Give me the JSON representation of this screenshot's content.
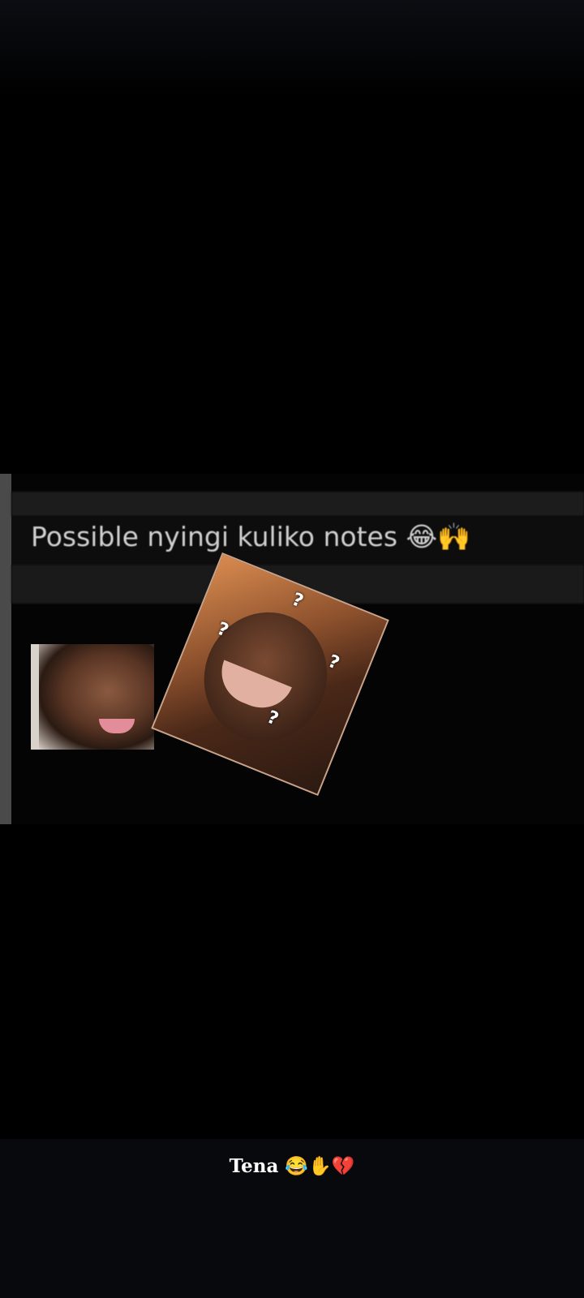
{
  "story": {
    "image_text": "Possible nyingi kuliko notes 😂🙌",
    "sticker_marks": [
      "?",
      "?",
      "?",
      "?"
    ]
  },
  "caption": {
    "text": "Tena 😂✋💔"
  },
  "colors": {
    "background": "#000000",
    "caption_bar": "#07090d",
    "caption_text": "#ffffff",
    "image_text": "#cfcfcf"
  }
}
